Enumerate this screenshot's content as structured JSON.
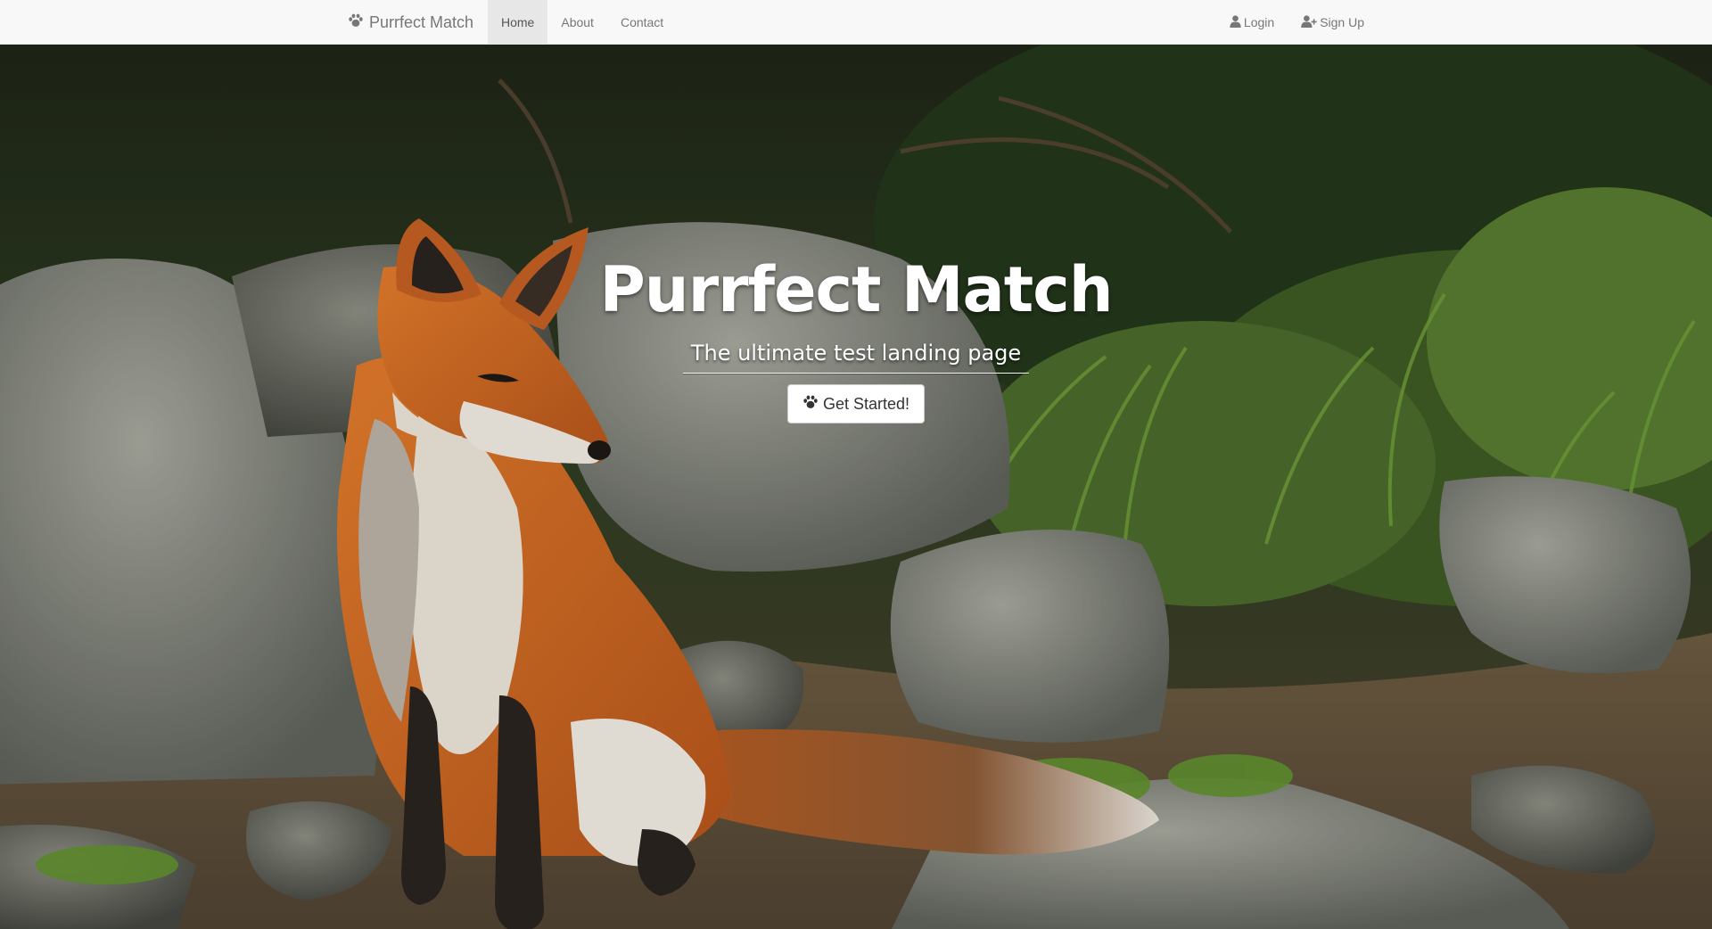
{
  "navbar": {
    "brand": "Purrfect Match",
    "brand_icon": "paw-icon",
    "left_links": [
      {
        "label": "Home",
        "active": true
      },
      {
        "label": "About",
        "active": false
      },
      {
        "label": "Contact",
        "active": false
      }
    ],
    "right_links": [
      {
        "label": "Login",
        "icon": "user-icon"
      },
      {
        "label": "Sign Up",
        "icon": "user-plus-icon"
      }
    ]
  },
  "hero": {
    "title": "Purrfect Match",
    "subtitle": "The ultimate test landing page",
    "cta_label": "Get Started!",
    "cta_icon": "paw-icon",
    "background": "photo of a red fox sitting among mossy rocks and green grass"
  },
  "colors": {
    "navbar_bg": "#f8f8f8",
    "nav_text": "#777777",
    "active_bg": "#e7e7e7"
  }
}
